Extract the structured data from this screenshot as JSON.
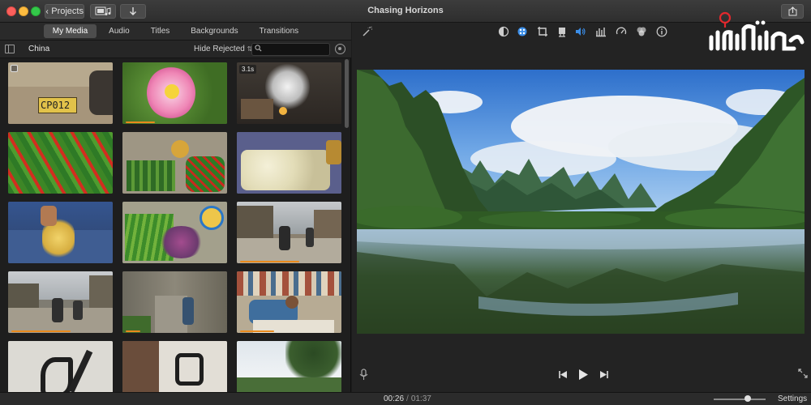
{
  "window": {
    "title": "Chasing Horizons"
  },
  "toolbar": {
    "projects_label": "Projects",
    "media_icon": "film-strip-music-icon",
    "import_icon": "import-arrow-icon",
    "share_icon": "share-icon"
  },
  "browser_tabs": [
    {
      "label": "My Media",
      "active": true
    },
    {
      "label": "Audio",
      "active": false
    },
    {
      "label": "Titles",
      "active": false
    },
    {
      "label": "Backgrounds",
      "active": false
    },
    {
      "label": "Transitions",
      "active": false
    }
  ],
  "library": {
    "album": "China",
    "filter": "Hide Rejected",
    "search_placeholder": ""
  },
  "clips": [
    {
      "duration_badge": "",
      "used": 0.0
    },
    {
      "duration_badge": "",
      "used": 0.3
    },
    {
      "duration_badge": "3.1s",
      "used": 0.0
    },
    {
      "duration_badge": "",
      "used": 0.0
    },
    {
      "duration_badge": "",
      "used": 0.0
    },
    {
      "duration_badge": "",
      "used": 0.0
    },
    {
      "duration_badge": "",
      "used": 0.0
    },
    {
      "duration_badge": "",
      "used": 0.0
    },
    {
      "duration_badge": "",
      "used": 0.6
    },
    {
      "duration_badge": "",
      "used": 0.6
    },
    {
      "duration_badge": "",
      "used": 0.15
    },
    {
      "duration_badge": "",
      "used": 0.35
    },
    {
      "duration_badge": "",
      "used": 0.0
    },
    {
      "duration_badge": "",
      "used": 0.0
    },
    {
      "duration_badge": "",
      "used": 0.0
    }
  ],
  "adjust_tools": [
    "magic-wand-icon",
    "color-balance-icon",
    "color-correction-icon",
    "crop-icon",
    "stabilization-icon",
    "volume-icon",
    "noise-reduction-eq-icon",
    "speed-icon",
    "clip-filter-icon",
    "info-icon"
  ],
  "playback": {
    "current_time": "00:26",
    "total_time": "01:37"
  },
  "bottom": {
    "settings_label": "Settings"
  },
  "colors": {
    "accent": "#e98a1d",
    "active_tool": "#3b8ee8"
  }
}
